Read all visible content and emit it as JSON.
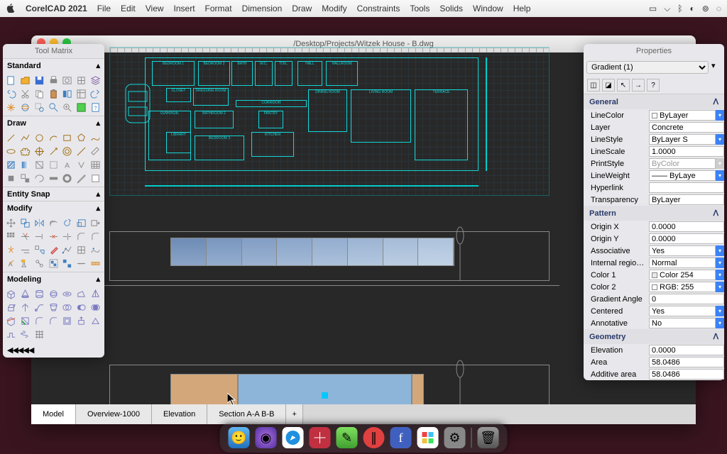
{
  "menubar": {
    "app": "CorelCAD 2021",
    "items": [
      "File",
      "Edit",
      "View",
      "Insert",
      "Format",
      "Dimension",
      "Draw",
      "Modify",
      "Constraints",
      "Tools",
      "Solids",
      "Window",
      "Help"
    ]
  },
  "window": {
    "title": "/Desktop/Projects/Witzek House - B.dwg"
  },
  "toolmatrix": {
    "title": "Tool Matrix",
    "sections": {
      "standard": "Standard",
      "draw": "Draw",
      "entitysnap": "Entity Snap",
      "modify": "Modify",
      "modeling": "Modeling"
    },
    "footer": "◀◀◀◀◀"
  },
  "floorplan": {
    "rooms": [
      "BEDROOM 1",
      "BEDROOM 2",
      "CLOSET",
      "DRESSING ROOM",
      "BATH",
      "BATHROOM 2",
      "CORRIDOR",
      "PANTRY",
      "KITCHEN",
      "DINING ROOM",
      "LIVING ROOM",
      "HALL",
      "HALLROOM",
      "GARAGE",
      "LIBRARY",
      "BEDROOM 3",
      "TERRACE",
      "W.C.",
      "TOIL."
    ]
  },
  "model_tabs": {
    "items": [
      "Model",
      "Overview-1000",
      "Elevation",
      "Section A-A B-B"
    ],
    "add": "+"
  },
  "properties": {
    "title": "Properties",
    "selection": "Gradient (1)",
    "pick_icons": [
      "◫",
      "◪",
      "↖",
      "→",
      "?"
    ],
    "sections": {
      "general": "General",
      "pattern": "Pattern",
      "geometry": "Geometry"
    },
    "general": {
      "LineColor": "ByLayer",
      "Layer": "Concrete",
      "LineStyle": "ByLayer    S",
      "LineScale": "1.0000",
      "PrintStyle": "ByColor",
      "LineWeight": "—— ByLaye",
      "Hyperlink": "",
      "Transparency": "ByLayer"
    },
    "pattern": {
      "Origin X": "0.0000",
      "Origin Y": "0.0000",
      "Associative": "Yes",
      "Internal regio…": "Normal",
      "Color 1": "Color 254",
      "Color 2": "RGB: 255",
      "Gradient Angle": "0",
      "Centered": "Yes",
      "Annotative": "No"
    },
    "geometry": {
      "Elevation": "0.0000",
      "Area": "58.0486",
      "Additive area": "58.0486"
    }
  },
  "dock": {
    "items": [
      "finder",
      "siri",
      "safari",
      "corelcad",
      "notes",
      "parallels",
      "font",
      "color-sync",
      "system-prefs"
    ],
    "trash": "trash"
  }
}
